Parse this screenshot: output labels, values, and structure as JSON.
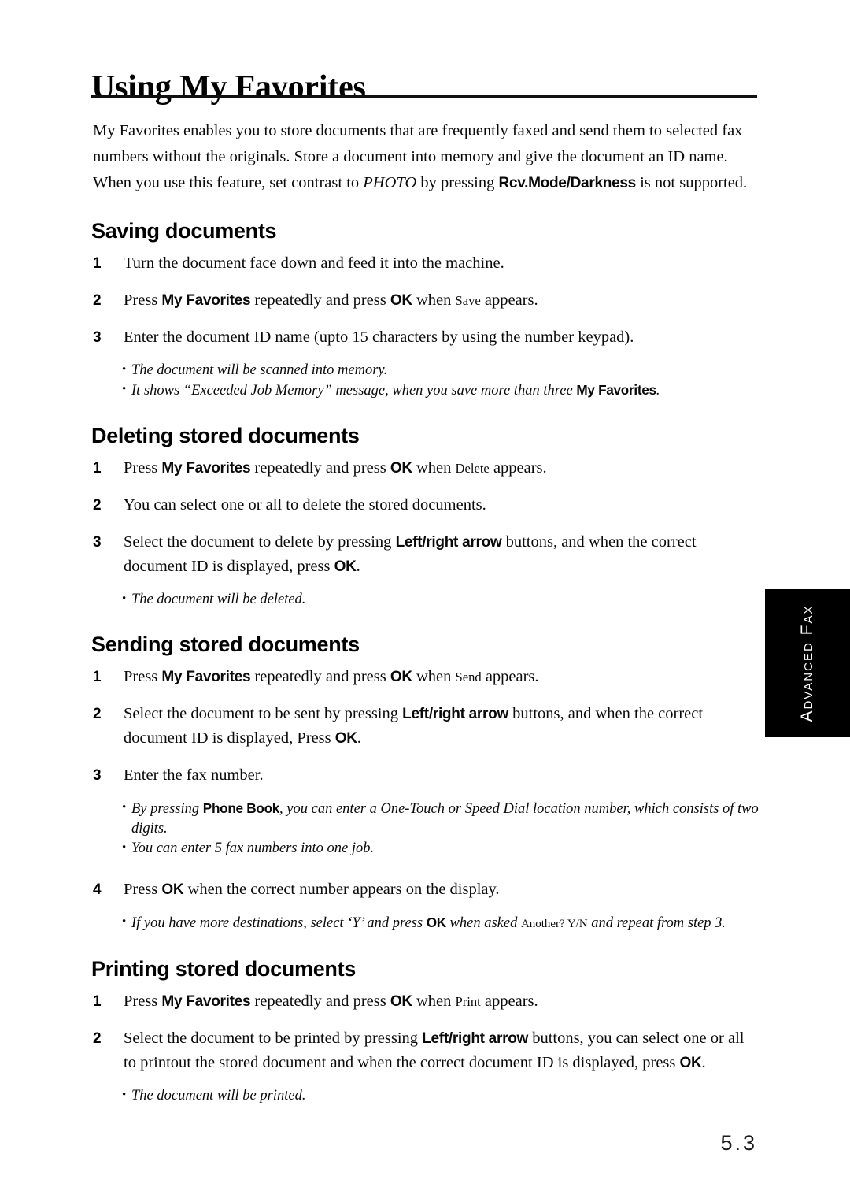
{
  "page": {
    "title": "Using My Favorites",
    "folio": "5.3",
    "side_tab": "Advanced Fax",
    "side_tab_color": "#000000",
    "text_color": "#0a0a0a"
  },
  "intro": {
    "part1": "My Favorites enables you to store documents that are frequently faxed and send them to selected fax numbers without the originals. Store a document into memory and give the document an ID name. When you use this feature, set contrast to ",
    "photo": "PHOTO",
    "part2": " by pressing ",
    "button": "Rcv.Mode/Darkness",
    "part3": " is not supported."
  },
  "sections": [
    {
      "heading": "Saving documents",
      "steps": [
        {
          "num": "1",
          "part1": "Turn the document face down and feed it into the machine."
        },
        {
          "num": "2",
          "part1": "Press ",
          "b1": "My Favorites",
          "part2": " repeatedly and press ",
          "b2": "OK",
          "part3": " when ",
          "disp": "Save",
          "part4": " appears."
        },
        {
          "num": "3",
          "part1": "Enter the document ID name (upto 15 characters by using the number keypad)."
        }
      ],
      "notes": [
        {
          "part1": "The document will be scanned into memory."
        },
        {
          "part1": "It shows “Exceeded Job Memory” message, when you save more than three ",
          "b1": "My Favorites",
          "part2": "."
        }
      ]
    },
    {
      "heading": "Deleting stored documents",
      "steps": [
        {
          "num": "1",
          "part1": "Press ",
          "b1": "My Favorites",
          "part2": " repeatedly and press ",
          "b2": "OK",
          "part3": " when ",
          "disp": "Delete",
          "part4": " appears."
        },
        {
          "num": "2",
          "part1": "You can select one or all to delete the stored documents."
        },
        {
          "num": "3",
          "part1": "Select the document to delete by pressing ",
          "b1": "Left/right arrow",
          "part2": " buttons, and when the correct document ID is displayed, press ",
          "b2": "OK",
          "part3": "."
        }
      ],
      "notes": [
        {
          "part1": "The document will be deleted."
        }
      ]
    },
    {
      "heading": "Sending stored documents",
      "steps": [
        {
          "num": "1",
          "part1": "Press ",
          "b1": "My Favorites",
          "part2": " repeatedly and press ",
          "b2": "OK",
          "part3": " when ",
          "disp": "Send",
          "part4": " appears."
        },
        {
          "num": "2",
          "part1": "Select the document to be sent by pressing ",
          "b1": "Left/right arrow",
          "part2": " buttons, and when the correct document ID is displayed, Press ",
          "b2": "OK",
          "part3": "."
        },
        {
          "num": "3",
          "part1": "Enter the fax number."
        }
      ],
      "notes": [
        {
          "part1": "By pressing ",
          "b1": "Phone Book",
          "part2": ", you can enter a One-Touch or Speed Dial location number, which consists of two digits."
        },
        {
          "part1": "You can enter 5 fax numbers into one job."
        }
      ],
      "steps2": [
        {
          "num": "4",
          "part1": "Press ",
          "b1": "OK",
          "part2": " when the correct number appears on the display."
        }
      ],
      "notes2": [
        {
          "part1": "If you have more destinations, select ‘Y’ and press ",
          "b1": "OK",
          "part2": " when asked ",
          "disp": "Another? Y/N",
          "part3": " and repeat from step 3."
        }
      ]
    },
    {
      "heading": "Printing stored documents",
      "steps": [
        {
          "num": "1",
          "part1": "Press ",
          "b1": "My Favorites",
          "part2": " repeatedly and press ",
          "b2": "OK",
          "part3": " when ",
          "disp": "Print",
          "part4": " appears."
        },
        {
          "num": "2",
          "part1": "Select the document to be printed by pressing ",
          "b1": "Left/right arrow",
          "part2": " buttons, you can select one or all to printout the stored document and when the correct document ID is displayed, press ",
          "b2": "OK",
          "part3": "."
        }
      ],
      "notes": [
        {
          "part1": "The document will be printed."
        }
      ]
    }
  ]
}
